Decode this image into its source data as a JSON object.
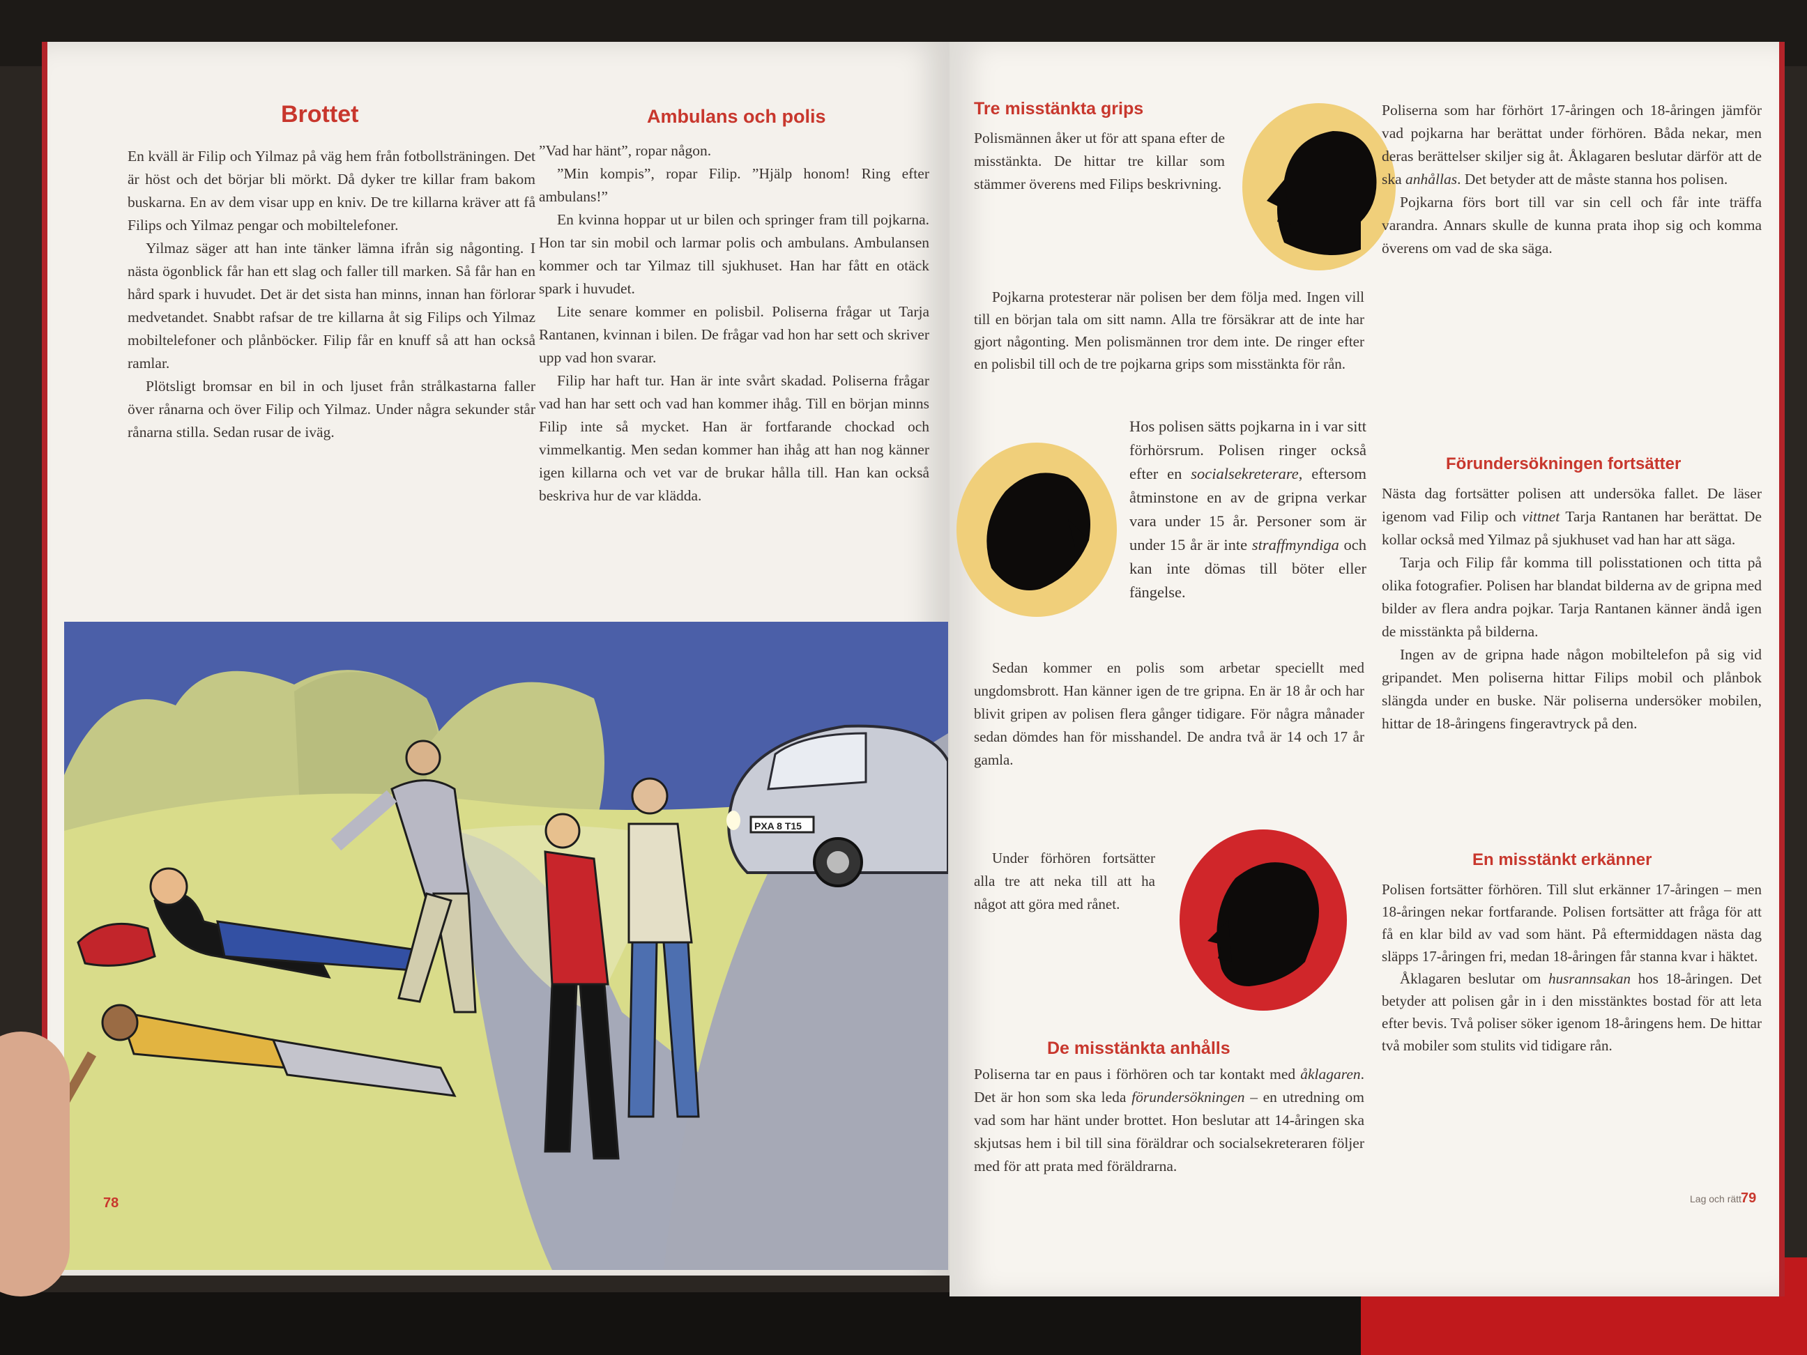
{
  "left_page": {
    "heading_brottet": "Brottet",
    "brottet_paragraphs": [
      "En kväll är Filip och Yilmaz på väg hem från fotbollsträningen. Det är höst och det börjar bli mörkt. Då dyker tre killar fram bakom buskarna. En av dem visar upp en kniv. De tre killarna kräver att få Filips och Yilmaz pengar och mobiltelefoner.",
      "Yilmaz säger att han inte tänker lämna ifrån sig någonting. I nästa ögonblick får han ett slag och faller till marken. Så får han en hård spark i huvudet. Det är det sista han minns, innan han förlorar medvetandet. Snabbt rafsar de tre killarna åt sig Filips och Yilmaz mobiltelefoner och plånböcker. Filip får en knuff så att han också ramlar.",
      "Plötsligt bromsar en bil in och ljuset från strålkastarna faller över rånarna och över Filip och Yilmaz. Under några sekunder står rånarna stilla. Sedan rusar de iväg."
    ],
    "heading_ambulans": "Ambulans och polis",
    "ambulans_paragraphs": [
      "”Vad har hänt”, ropar någon.",
      "”Min kompis”, ropar Filip. ”Hjälp honom! Ring efter ambulans!”",
      "En kvinna hoppar ut ur bilen och springer fram till pojkarna. Hon tar sin mobil och larmar polis och ambulans. Ambulansen kommer och tar Yilmaz till sjukhuset. Han har fått en otäck spark i huvudet.",
      "Lite senare kommer en polisbil. Poliserna frågar ut Tarja Rantanen, kvinnan i bilen. De frågar vad hon har sett och skriver upp vad hon svarar.",
      "Filip har haft tur. Han är inte svårt skadad. Poliserna frågar vad han har sett och vad han kommer ihåg. Till en början minns Filip inte så mycket. Han är fortfarande chockad och vimmelkantig. Men sedan kommer han ihåg att han nog känner igen killarna och vet var de brukar hålla till. Han kan också beskriva hur de var klädda."
    ],
    "car_plate": "PXA 8 T15",
    "page_number": "78"
  },
  "right_page": {
    "heading_grips": "Tre misstänkta grips",
    "grips_paragraphs": [
      "Polismännen åker ut för att spana efter de misstänkta. De hittar tre killar som stämmer överens med Filips beskrivning.",
      "Pojkarna protesterar när polisen ber dem följa med. Ingen vill till en början tala om sitt namn. Alla tre försäkrar att de inte har gjort någonting. Men polismännen tror dem inte. De ringer efter en polisbil till och de tre pojkarna grips som misstänkta för rån."
    ],
    "grips_term": "grips",
    "hos_polisen_pre": "Hos polisen sätts pojkarna in i var sitt förhörsrum. Polisen ringer också efter en",
    "term_socialsekreterare": "socialsekreterare",
    "hos_polisen_mid": ", eftersom åtminstone en av de gripna verkar vara under 15 år. Personer som är under 15 år är inte",
    "term_straffmyndiga": "straffmyndiga",
    "hos_polisen_post": "och kan inte dömas till böter eller fängelse.",
    "ungdomsbrott_paragraph": "Sedan kommer en polis som arbetar speciellt med ungdomsbrott. Han känner igen de tre gripna. En är 18 år och har blivit gripen av polisen flera gånger tidigare. För några månader sedan dömdes han för misshandel. De andra två är 14 och 17 år gamla.",
    "forhoren_paragraph": "Under förhören fortsätter alla tre att neka till att ha något att göra med rånet.",
    "heading_anhalls": "De misstänkta anhålls",
    "anhalls_pre": "Poliserna tar en paus i förhören och tar kontakt med",
    "term_aklagaren": "åklagaren",
    "anhalls_mid": ". Det är hon som ska leda",
    "term_forundersokningen": "förundersökningen",
    "anhalls_post": "– en utredning om vad som har hänt under brottet. Hon beslutar att 14-åringen ska skjutsas hem i bil till sina föräldrar och socialsekreteraren följer med för att prata med föräldrarna.",
    "forhort_pre": "Poliserna som har förhört 17-åringen och 18-åringen jämför vad pojkarna har berättat under förhören. Båda nekar, men deras berättelser skiljer sig åt. Åklagaren beslutar därför att de ska",
    "term_anhallas": "anhållas",
    "forhort_post": ". Det betyder att de måste stanna hos polisen.",
    "cell_paragraph": "Pojkarna förs bort till var sin cell och får inte träffa varandra. Annars skulle de kunna prata ihop sig och komma överens om vad de ska säga.",
    "heading_fortsatter": "Förundersökningen fortsätter",
    "fortsatter_pre": "Nästa dag fortsätter polisen att undersöka fallet. De läser igenom vad Filip och",
    "term_vittnet": "vittnet",
    "fortsatter_post": "Tarja Rantanen har berättat. De kollar också med Yilmaz på sjukhuset vad han har att säga.",
    "fotografier_paragraph": "Tarja och Filip får komma till polisstationen och titta på olika fotografier. Polisen har blandat bilderna av de gripna med bilder av flera andra pojkar. Tarja Rantanen känner ändå igen de misstänkta på bilderna.",
    "mobil_paragraph": "Ingen av de gripna hade någon mobiltelefon på sig vid gripandet. Men poliserna hittar Filips mobil och plånbok slängda under en buske. När poliserna undersöker mobilen, hittar de 18-åringens fingeravtryck på den.",
    "heading_erkanner": "En misstänkt erkänner",
    "erkanner_paragraph": "Polisen fortsätter förhören. Till slut erkänner 17-åringen – men 18-åringen nekar fortfarande. Polisen fortsätter att fråga för att få en klar bild av vad som hänt. På eftermiddagen nästa dag släpps 17-åringen fri, medan 18-åringen får stanna kvar i häktet.",
    "husrannsakan_pre": "Åklagaren beslutar om",
    "term_husrannsakan": "husrannsakan",
    "husrannsakan_post": "hos 18-åringen. Det betyder att polisen går in i den misstänktes bostad för att leta efter bevis. Två poliser söker igenom 18-åringens hem. De hittar två mobiler som stulits vid tidigare rån.",
    "footer_label": "Lag och rätt",
    "page_number": "79"
  },
  "colors": {
    "heading_red": "#c8372d",
    "silhouette_yellow": "#f0cf7a",
    "silhouette_red": "#d0262a",
    "sky_blue": "#4b5fa8",
    "ground_yellow": "#d9dc8a"
  }
}
